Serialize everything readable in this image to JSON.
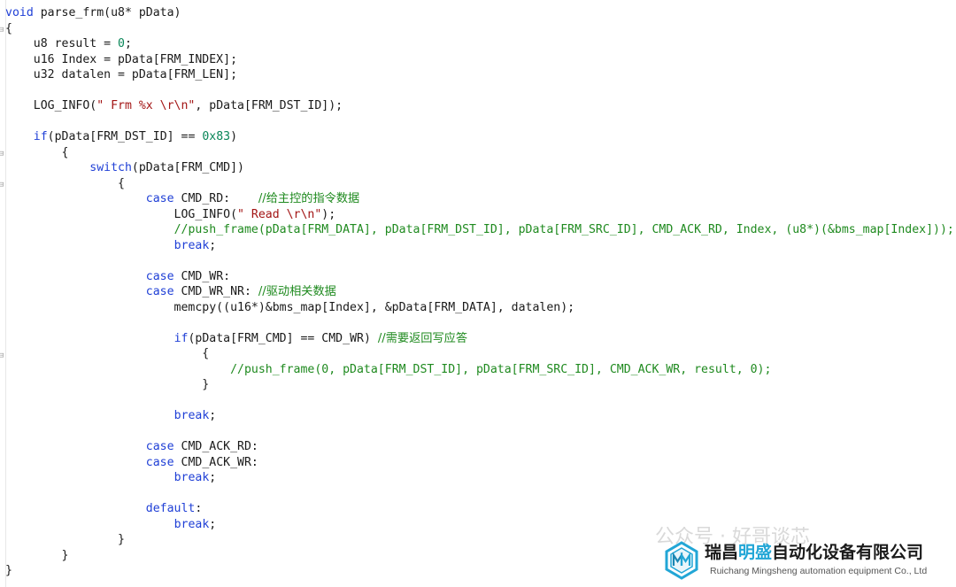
{
  "editor": {
    "lines": [
      [
        {
          "t": "void",
          "c": "kw"
        },
        {
          "t": " parse_frm(u8* pData)"
        }
      ],
      [
        {
          "t": "{"
        }
      ],
      [
        {
          "t": "    u8 result = "
        },
        {
          "t": "0",
          "c": "num"
        },
        {
          "t": ";"
        }
      ],
      [
        {
          "t": "    u16 Index = pData[FRM_INDEX];"
        }
      ],
      [
        {
          "t": "    u32 datalen = pData[FRM_LEN];"
        }
      ],
      [],
      [
        {
          "t": "    LOG_INFO("
        },
        {
          "t": "\" Frm %x \\r\\n\"",
          "c": "str"
        },
        {
          "t": ", pData[FRM_DST_ID]);"
        }
      ],
      [],
      [
        {
          "t": "    "
        },
        {
          "t": "if",
          "c": "kw"
        },
        {
          "t": "(pData[FRM_DST_ID] == "
        },
        {
          "t": "0x83",
          "c": "num"
        },
        {
          "t": ")"
        }
      ],
      [
        {
          "t": "        {"
        }
      ],
      [
        {
          "t": "            "
        },
        {
          "t": "switch",
          "c": "kw"
        },
        {
          "t": "(pData[FRM_CMD])"
        }
      ],
      [
        {
          "t": "                {"
        }
      ],
      [
        {
          "t": "                    "
        },
        {
          "t": "case",
          "c": "kw"
        },
        {
          "t": " CMD_RD:    "
        },
        {
          "t": "//给主控的指令数据",
          "c": "cm"
        }
      ],
      [
        {
          "t": "                        LOG_INFO("
        },
        {
          "t": "\" Read \\r\\n\"",
          "c": "str"
        },
        {
          "t": ");"
        }
      ],
      [
        {
          "t": "                        "
        },
        {
          "t": "//push_frame(pData[FRM_DATA], pData[FRM_DST_ID], pData[FRM_SRC_ID], CMD_ACK_RD, Index, (u8*)(&bms_map[Index]));",
          "c": "cm"
        }
      ],
      [
        {
          "t": "                        "
        },
        {
          "t": "break",
          "c": "kw"
        },
        {
          "t": ";"
        }
      ],
      [],
      [
        {
          "t": "                    "
        },
        {
          "t": "case",
          "c": "kw"
        },
        {
          "t": " CMD_WR:"
        }
      ],
      [
        {
          "t": "                    "
        },
        {
          "t": "case",
          "c": "kw"
        },
        {
          "t": " CMD_WR_NR: "
        },
        {
          "t": "//驱动相关数据",
          "c": "cm"
        }
      ],
      [
        {
          "t": "                        memcpy((u16*)&bms_map[Index], &pData[FRM_DATA], datalen);"
        }
      ],
      [],
      [
        {
          "t": "                        "
        },
        {
          "t": "if",
          "c": "kw"
        },
        {
          "t": "(pData[FRM_CMD] == CMD_WR) "
        },
        {
          "t": "//需要返回写应答",
          "c": "cm"
        }
      ],
      [
        {
          "t": "                            {"
        }
      ],
      [
        {
          "t": "                                "
        },
        {
          "t": "//push_frame(0, pData[FRM_DST_ID], pData[FRM_SRC_ID], CMD_ACK_WR, result, 0);",
          "c": "cm"
        }
      ],
      [
        {
          "t": "                            }"
        }
      ],
      [],
      [
        {
          "t": "                        "
        },
        {
          "t": "break",
          "c": "kw"
        },
        {
          "t": ";"
        }
      ],
      [],
      [
        {
          "t": "                    "
        },
        {
          "t": "case",
          "c": "kw"
        },
        {
          "t": " CMD_ACK_RD:"
        }
      ],
      [
        {
          "t": "                    "
        },
        {
          "t": "case",
          "c": "kw"
        },
        {
          "t": " CMD_ACK_WR:"
        }
      ],
      [
        {
          "t": "                        "
        },
        {
          "t": "break",
          "c": "kw"
        },
        {
          "t": ";"
        }
      ],
      [],
      [
        {
          "t": "                    "
        },
        {
          "t": "default",
          "c": "kw"
        },
        {
          "t": ":"
        }
      ],
      [
        {
          "t": "                        "
        },
        {
          "t": "break",
          "c": "kw"
        },
        {
          "t": ";"
        }
      ],
      [
        {
          "t": "                }"
        }
      ],
      [
        {
          "t": "        }"
        }
      ],
      [
        {
          "t": "}"
        }
      ]
    ]
  },
  "colors": {
    "keyword": "#1f3fd6",
    "string": "#a31515",
    "number": "#098658",
    "comment": "#1f8a1f",
    "brand": "#22a6d6"
  },
  "watermark": {
    "wechat_text": "公众号 · 好哥谈芯",
    "company_name_pre": "瑞昌",
    "company_name_highlight": "明盛",
    "company_name_post": "自动化设备有限公司",
    "company_name_en": "Ruichang Mingsheng automation equipment Co., Ltd",
    "logo_icon": "hexagon-mm-logo-icon"
  }
}
